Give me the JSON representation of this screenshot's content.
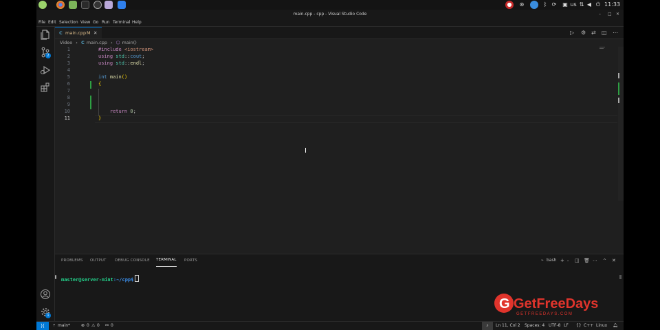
{
  "os_panel": {
    "keyboard_layout": "us",
    "clock": "11:33"
  },
  "window": {
    "title": "main.cpp - cpp - Visual Studio Code"
  },
  "menu": [
    "File",
    "Edit",
    "Selection",
    "View",
    "Go",
    "Run",
    "Terminal",
    "Help"
  ],
  "activity_bar": {
    "source_control_badge": "2",
    "manage_badge": "1"
  },
  "tab": {
    "label": "main.cpp",
    "modified": "M"
  },
  "breadcrumb": {
    "folder": "Video",
    "file": "main.cpp",
    "symbol": "main()"
  },
  "editor": {
    "line_numbers": [
      "1",
      "2",
      "3",
      "4",
      "5",
      "6",
      "7",
      "8",
      "9",
      "10",
      "11"
    ],
    "current_line": "11"
  },
  "panel": {
    "tabs": [
      "PROBLEMS",
      "OUTPUT",
      "DEBUG CONSOLE",
      "TERMINAL",
      "PORTS"
    ],
    "active_tab": "TERMINAL",
    "shell": "bash",
    "prompt_user": "master@server-mint",
    "prompt_path": ":~/cpp$"
  },
  "watermark": {
    "brand": "GetFreeDays",
    "url": "GETFREEDAYS.COM"
  },
  "status_bar": {
    "branch": "main*",
    "errors": "0",
    "warnings": "0",
    "ports": "0",
    "position": "Ln 11, Col 2",
    "spaces": "Spaces: 4",
    "encoding": "UTF-8",
    "eol": "LF",
    "language": "C++",
    "platform": "Linux"
  },
  "colors": {
    "accent": "#0078d4",
    "editor_bg": "#1f1f1f",
    "chrome_bg": "#181818",
    "git_added": "#2ea043",
    "watermark_red": "#e0342c"
  }
}
